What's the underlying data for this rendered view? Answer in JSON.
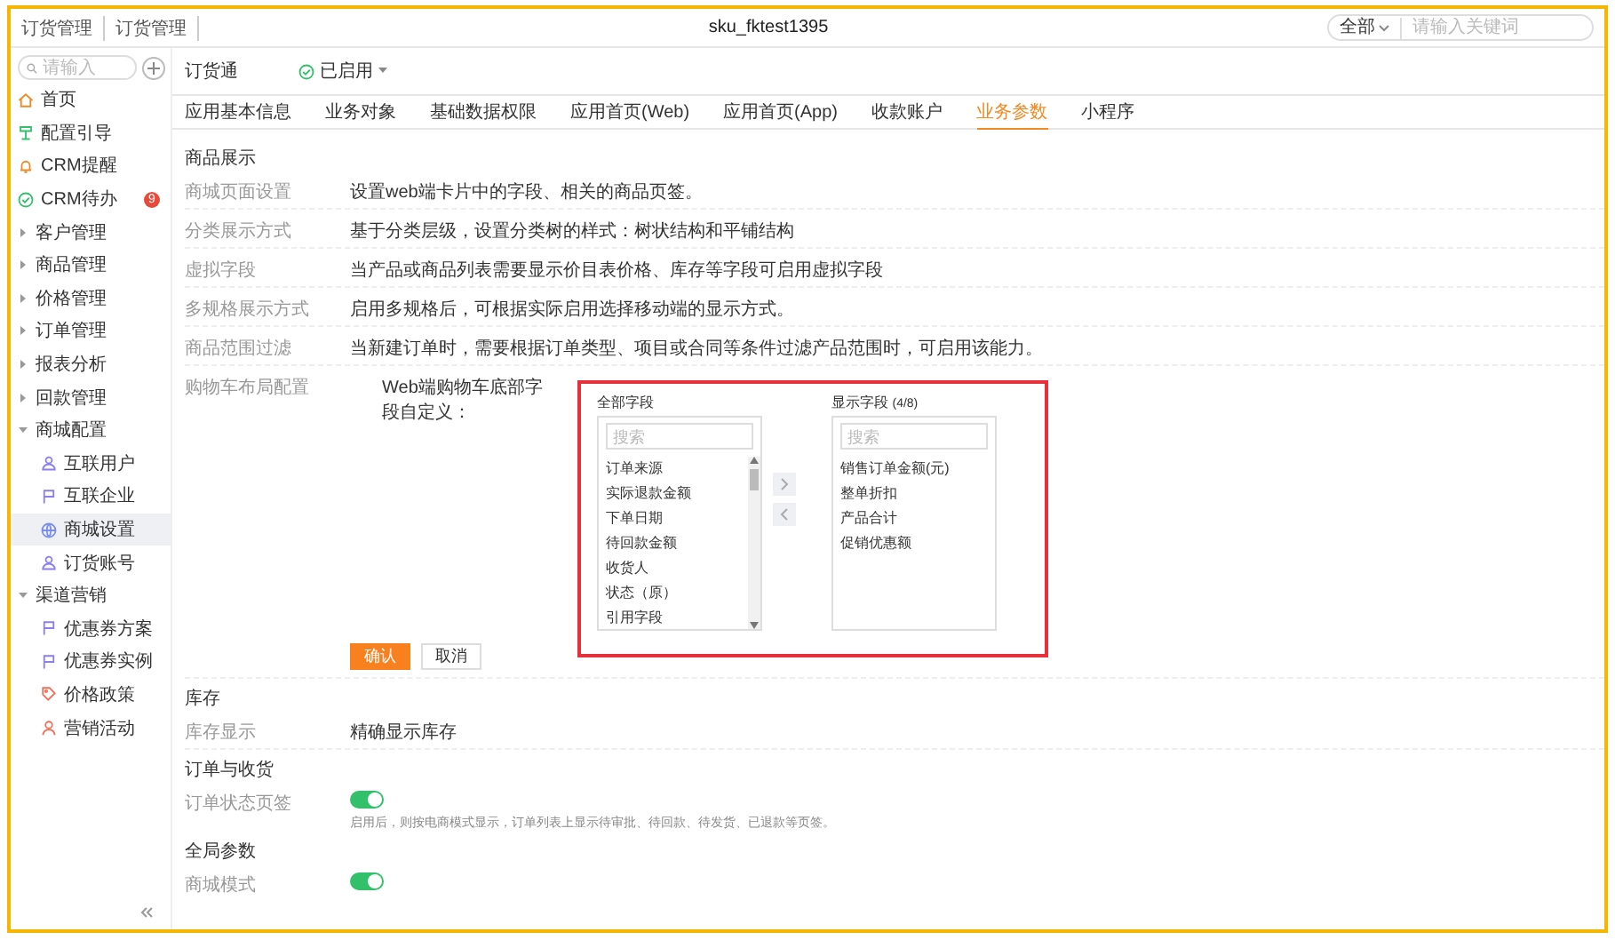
{
  "top_bar": {
    "breadcrumbs": [
      "订货管理",
      "订货管理"
    ],
    "title": "sku_fktest1395",
    "scope_select": "全部",
    "search": {
      "placeholder": "请输入关键词"
    }
  },
  "sidebar": {
    "search": {
      "placeholder": "请输入"
    },
    "items": [
      {
        "label": "首页",
        "selected": false
      },
      {
        "label": "配置引导",
        "selected": false
      },
      {
        "label": "CRM提醒",
        "selected": false
      },
      {
        "label": "CRM待办",
        "selected": false,
        "badge": "9"
      },
      {
        "label": "客户管理",
        "expanded": false,
        "selected": false
      },
      {
        "label": "商品管理",
        "expanded": false,
        "selected": false
      },
      {
        "label": "价格管理",
        "expanded": false,
        "selected": false
      },
      {
        "label": "订单管理",
        "expanded": false,
        "selected": false
      },
      {
        "label": "报表分析",
        "expanded": false,
        "selected": false
      },
      {
        "label": "回款管理",
        "expanded": false,
        "selected": false
      },
      {
        "label": "商城配置",
        "expanded": true,
        "selected": false,
        "children": [
          {
            "label": "互联用户",
            "selected": false
          },
          {
            "label": "互联企业",
            "selected": false
          },
          {
            "label": "商城设置",
            "selected": true
          },
          {
            "label": "订货账号",
            "selected": false
          }
        ]
      },
      {
        "label": "渠道营销",
        "expanded": true,
        "selected": false,
        "children": [
          {
            "label": "优惠券方案",
            "selected": false
          },
          {
            "label": "优惠券实例",
            "selected": false
          },
          {
            "label": "价格政策",
            "selected": false
          },
          {
            "label": "营销活动",
            "selected": false
          }
        ]
      }
    ]
  },
  "app_header": {
    "name": "订货通",
    "status": "已启用",
    "enabled": true
  },
  "tabs": [
    {
      "label": "应用基本信息",
      "selected": false
    },
    {
      "label": "业务对象",
      "selected": false
    },
    {
      "label": "基础数据权限",
      "selected": false
    },
    {
      "label": "应用首页(Web)",
      "selected": false
    },
    {
      "label": "应用首页(App)",
      "selected": false
    },
    {
      "label": "收款账户",
      "selected": false
    },
    {
      "label": "业务参数",
      "selected": true
    },
    {
      "label": "小程序",
      "selected": false
    }
  ],
  "sections": [
    {
      "title": "商品展示",
      "rows": [
        {
          "kind": "text",
          "label": "商城页面设置",
          "value": "设置web端卡片中的字段、相关的商品页签。"
        },
        {
          "kind": "text",
          "label": "分类展示方式",
          "value": "基于分类层级，设置分类树的样式：树状结构和平铺结构"
        },
        {
          "kind": "text",
          "label": "虚拟字段",
          "value": "当产品或商品列表需要显示价目表价格、库存等字段可启用虚拟字段"
        },
        {
          "kind": "text",
          "label": "多规格展示方式",
          "value": "启用多规格后，可根据实际启用选择移动端的显示方式。"
        },
        {
          "kind": "text",
          "label": "商品范围过滤",
          "value": "当新建订单时，需要根据订单类型、项目或合同等条件过滤产品范围时，可启用该能力。"
        },
        {
          "kind": "transfer",
          "label": "购物车布局配置",
          "value": "Web端购物车底部字段自定义：",
          "transfer": {
            "left_title": "全部字段",
            "left_search": {
              "placeholder": "搜索"
            },
            "left_items": [
              "订单来源",
              "实际退款金额",
              "下单日期",
              "待回款金额",
              "收货人",
              "状态（原）",
              "引用字段"
            ],
            "right_title": "显示字段",
            "right_count": "(4/8)",
            "right_search": {
              "placeholder": "搜索"
            },
            "right_items": [
              "销售订单金额(元)",
              "整单折扣",
              "产品合计",
              "促销优惠额"
            ]
          },
          "confirm": "确认",
          "cancel": "取消"
        }
      ]
    },
    {
      "title": "库存",
      "rows": [
        {
          "kind": "text",
          "label": "库存显示",
          "value": "精确显示库存"
        }
      ]
    },
    {
      "title": "订单与收货",
      "rows": [
        {
          "kind": "toggle",
          "label": "订单状态页签",
          "on": true,
          "hint": "启用后，则按电商模式显示，订单列表上显示待审批、待回款、待发货、已退款等页签。"
        }
      ]
    },
    {
      "title": "全局参数",
      "rows": [
        {
          "kind": "toggle",
          "label": "商城模式",
          "on": true
        }
      ]
    }
  ]
}
